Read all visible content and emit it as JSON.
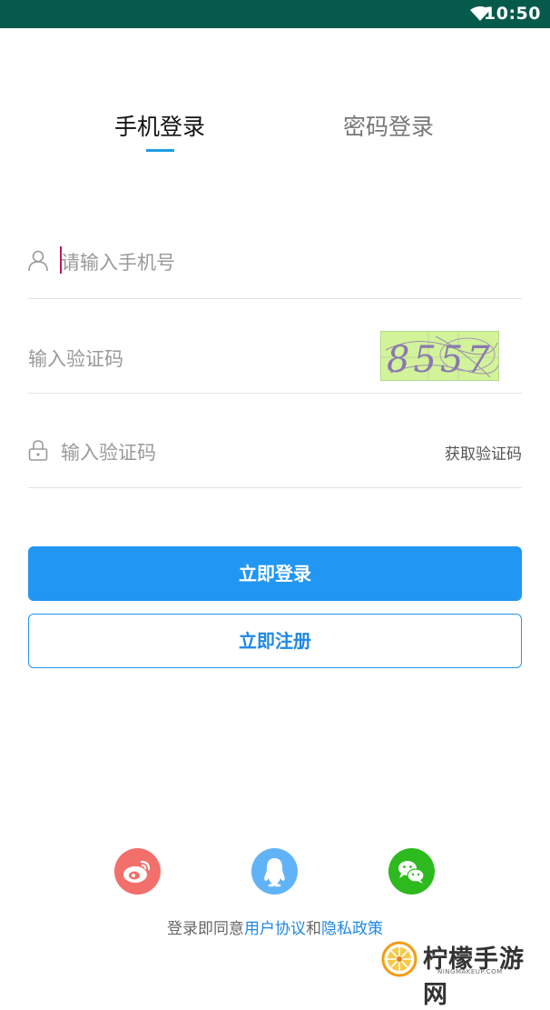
{
  "status_bar": {
    "time": "10:50",
    "icons": [
      "wifi-icon"
    ]
  },
  "tabs": [
    {
      "label": "手机登录",
      "active": true
    },
    {
      "label": "密码登录",
      "active": false
    }
  ],
  "form": {
    "phone": {
      "placeholder": "请输入手机号",
      "icon": "user-icon"
    },
    "captcha": {
      "placeholder": "输入验证码",
      "image_text": "8557"
    },
    "sms": {
      "placeholder": "输入验证码",
      "icon": "lock-icon",
      "get_code_label": "获取验证码"
    }
  },
  "buttons": {
    "login": "立即登录",
    "register": "立即注册"
  },
  "social": [
    {
      "name": "weibo",
      "icon": "weibo-icon",
      "color": "#f36f6c"
    },
    {
      "name": "qq",
      "icon": "qq-icon",
      "color": "#61b3f7"
    },
    {
      "name": "wechat",
      "icon": "wechat-icon",
      "color": "#2dba1f"
    }
  ],
  "agreement": {
    "prefix": "登录即同意",
    "user_agreement": "用户协议",
    "and": "和",
    "privacy_policy": "隐私政策"
  },
  "watermark": {
    "brand": "柠檬手游网",
    "domain": "NINGMAKEUP.COM"
  },
  "colors": {
    "status_bar": "#055a4c",
    "accent": "#2196f3",
    "tab_indicator": "#1e9ee3",
    "captcha_bg": "#d2f39a"
  }
}
